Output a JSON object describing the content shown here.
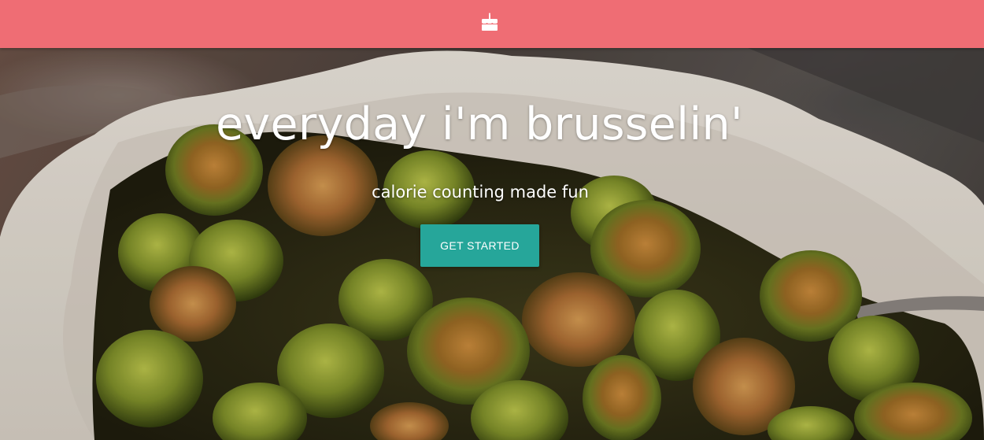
{
  "navbar": {
    "logo_icon": "cake-icon",
    "background_color": "#ef6d74"
  },
  "hero": {
    "image": "roasted-brussels-sprouts-photo",
    "title": "everyday i'm brusselin'",
    "subtitle": "calorie counting made fun",
    "cta_label": "GET STARTED",
    "cta_color": "#26a69a"
  }
}
